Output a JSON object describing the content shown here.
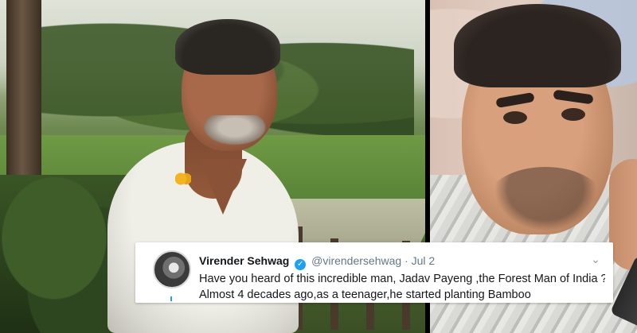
{
  "photo_left": {
    "subject": "man-in-field"
  },
  "photo_right": {
    "subject": "man-on-phone"
  },
  "tweet": {
    "author_name": "Virender Sehwag",
    "verified_icon": "verified-badge-icon",
    "handle": "@virendersehwag",
    "separator": "·",
    "date": "Jul 2",
    "menu_icon": "chevron-down-icon",
    "text_line_1": "Have you heard of this incredible man, Jadav Payeng ,the Forest Man of India ?",
    "text_line_2": "Almost 4 decades ago,as a teenager,he started planting Bamboo"
  },
  "colors": {
    "twitter_blue": "#1da1f2",
    "tweet_text": "#14171a",
    "meta_text": "#657786"
  }
}
